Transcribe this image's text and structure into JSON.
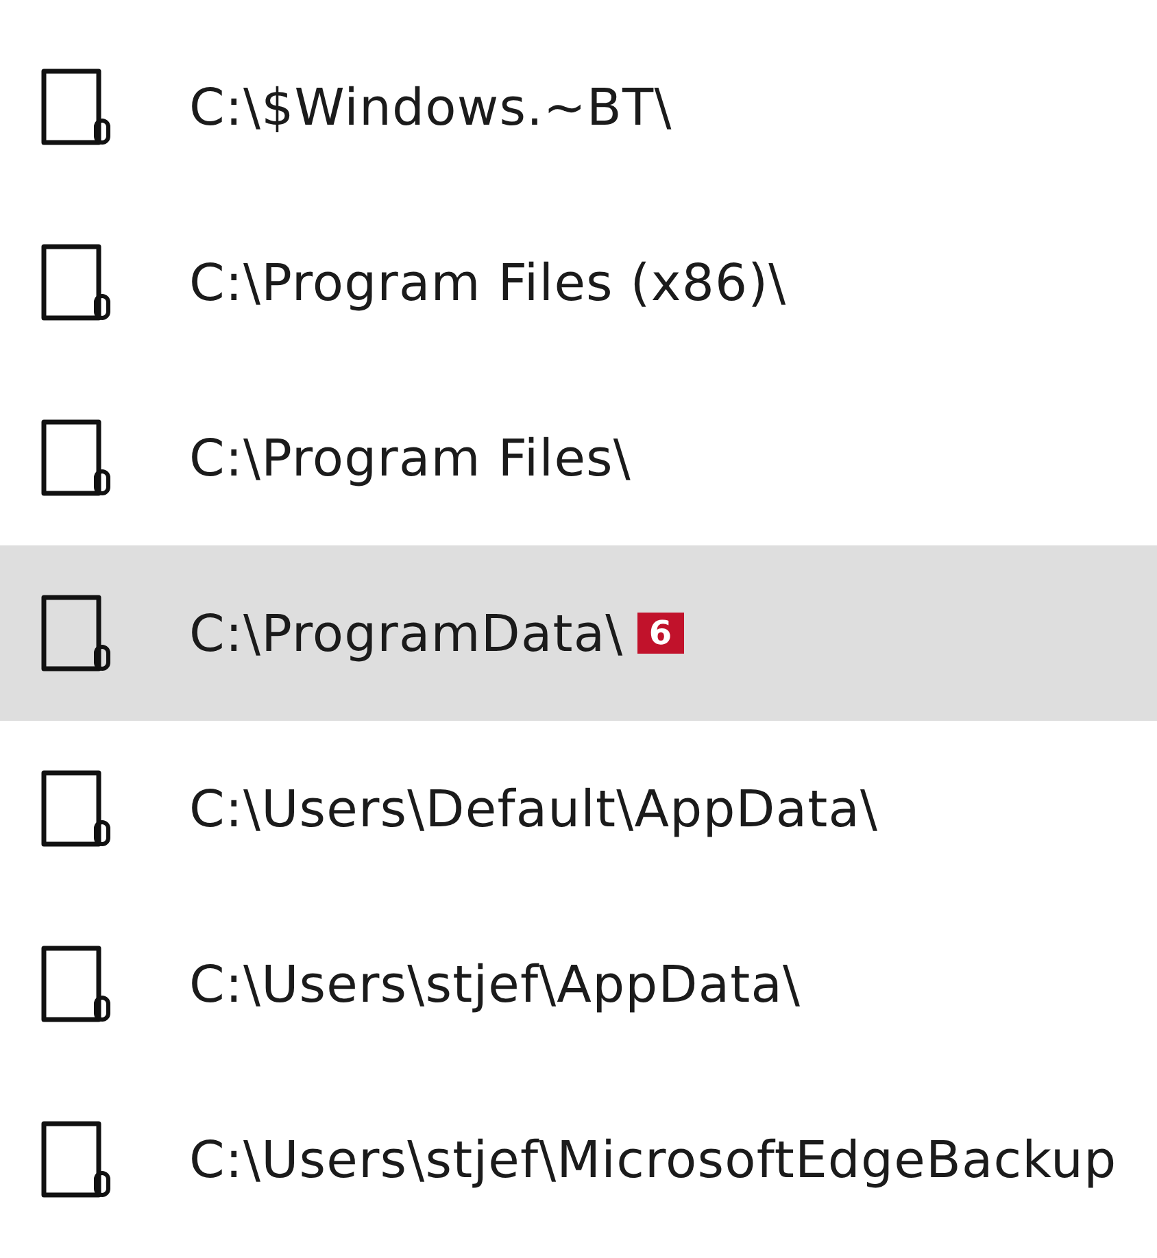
{
  "rows": [
    {
      "path": "C:\\$Windows.~BT\\",
      "selected": false
    },
    {
      "path": "C:\\Program Files (x86)\\",
      "selected": false
    },
    {
      "path": "C:\\Program Files\\",
      "selected": false
    },
    {
      "path": "C:\\ProgramData\\",
      "selected": true,
      "badge": "6"
    },
    {
      "path": "C:\\Users\\Default\\AppData\\",
      "selected": false
    },
    {
      "path": "C:\\Users\\stjef\\AppData\\",
      "selected": false
    },
    {
      "path": "C:\\Users\\stjef\\MicrosoftEdgeBackup",
      "selected": false
    }
  ]
}
